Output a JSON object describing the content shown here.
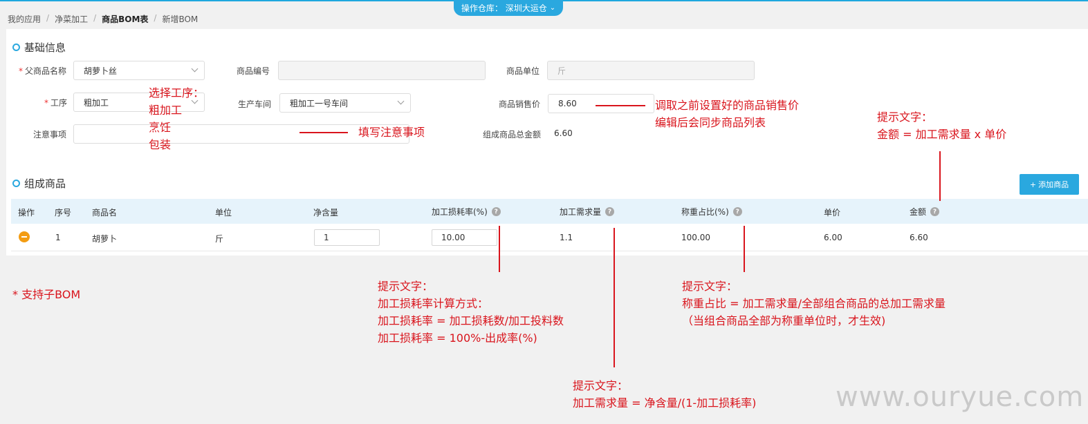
{
  "header": {
    "warehouse_label": "操作仓库：  深圳大运仓"
  },
  "breadcrumb": [
    "我的应用",
    "净菜加工",
    "商品BOM表",
    "新增BOM"
  ],
  "basic": {
    "title": "基础信息",
    "parent_name_label": "父商品名称",
    "parent_name_value": "胡萝卜丝",
    "code_label": "商品编号",
    "code_value": "",
    "unit_label": "商品单位",
    "unit_value": "斤",
    "process_label": "工序",
    "process_value": "粗加工",
    "workshop_label": "生产车间",
    "workshop_value": "粗加工一号车间",
    "price_label": "商品销售价",
    "price_value": "8.60",
    "notes_label": "注意事项",
    "notes_value": "",
    "total_label": "组成商品总金额",
    "total_value": "6.60"
  },
  "components": {
    "title": "组成商品",
    "add_label": "添加商品",
    "columns": [
      "操作",
      "序号",
      "商品名",
      "单位",
      "净含量",
      "加工损耗率(%)",
      "加工需求量",
      "称重占比(%)",
      "单价",
      "金额"
    ],
    "rows": [
      {
        "index": "1",
        "name": "胡萝卜",
        "unit": "斤",
        "net": "1",
        "loss": "10.00",
        "demand": "1.1",
        "ratio": "100.00",
        "price": "6.00",
        "amount": "6.60"
      }
    ]
  },
  "annotations": {
    "process_options": [
      "选择工序：",
      "粗加工",
      "烹饪",
      "包装"
    ],
    "notes_hint": "填写注意事项",
    "price_hint": [
      "调取之前设置好的商品销售价",
      "编辑后会同步商品列表"
    ],
    "amount_hint": [
      "提示文字：",
      "金额 = 加工需求量 x 单价"
    ],
    "sub_bom": "* 支持子BOM",
    "loss_hint": [
      "提示文字：",
      "加工损耗率计算方式：",
      "加工损耗率 = 加工损耗数/加工投料数",
      "加工损耗率 = 100%-出成率(%)"
    ],
    "ratio_hint": [
      "提示文字：",
      "称重占比 = 加工需求量/全部组合商品的总加工需求量",
      "（当组合商品全部为称重单位时，才生效)"
    ],
    "demand_hint": [
      "提示文字：",
      "加工需求量 = 净含量/(1-加工损耗率)"
    ]
  },
  "watermark": "www.ouryue.com"
}
